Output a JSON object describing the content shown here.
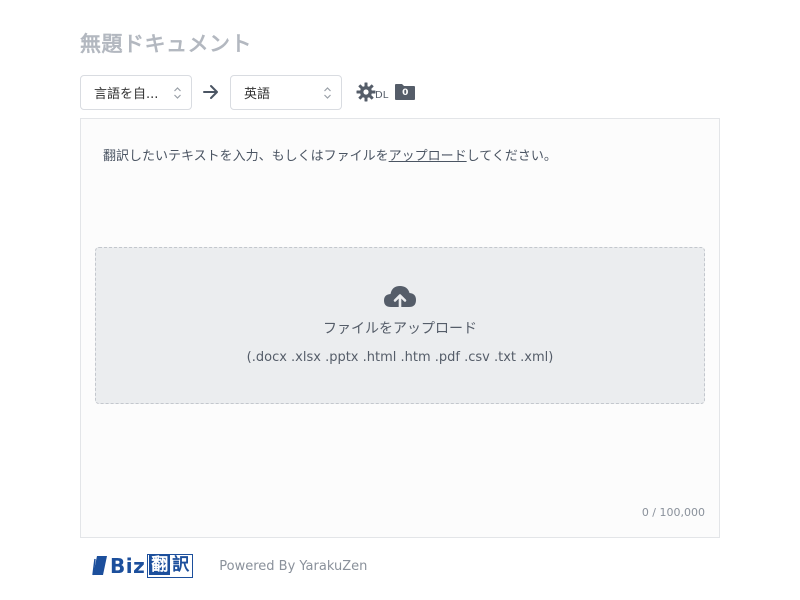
{
  "document": {
    "title": "無題ドキュメント"
  },
  "toolbar": {
    "source_language": "言語を自...",
    "target_language": "英語",
    "settings_label": "DL",
    "folder_count": "0"
  },
  "editor": {
    "prompt_before": "翻訳したいテキストを入力、もしくはファイルを",
    "prompt_link": "アップロード",
    "prompt_after": "してください。",
    "dropzone_title": "ファイルをアップロード",
    "dropzone_formats": "(.docx .xlsx .pptx .html .htm .pdf .csv .txt .xml)",
    "char_counter": "0 / 100,000"
  },
  "footer": {
    "logo_text": "Biz",
    "logo_kanji_1": "翻",
    "logo_kanji_2": "訳",
    "powered_by": "Powered By YarakuZen"
  },
  "colors": {
    "brand": "#1c4f9c",
    "title": "#b3b8c0",
    "dropzone_bg": "#ebedef"
  }
}
